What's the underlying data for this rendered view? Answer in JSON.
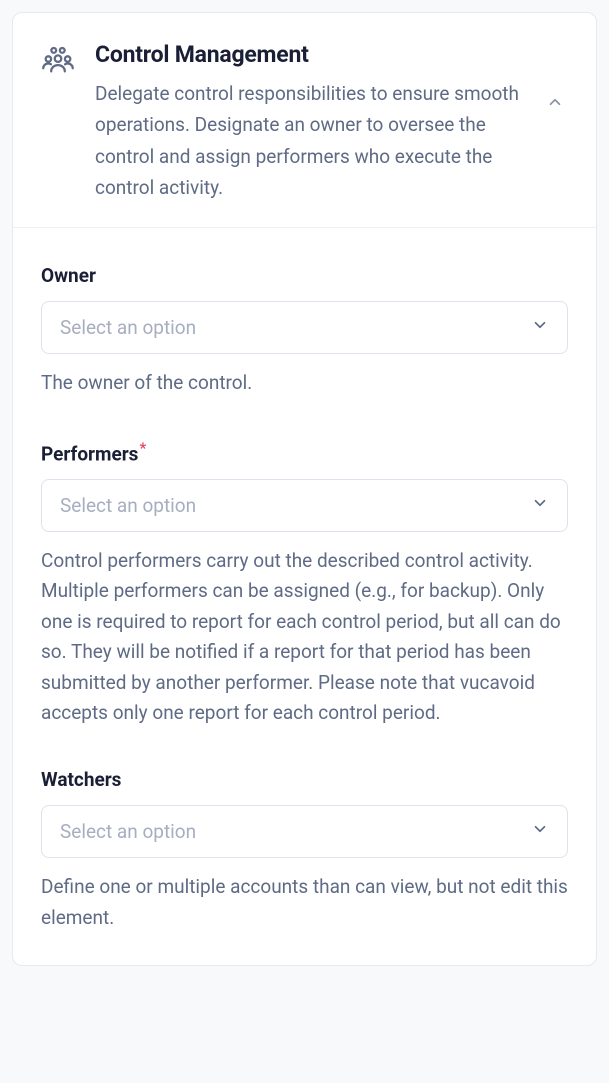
{
  "header": {
    "title": "Control Management",
    "description": "Delegate control responsibilities to ensure smooth operations. Designate an owner to oversee the control and assign performers who execute the control activity."
  },
  "fields": {
    "owner": {
      "label": "Owner",
      "required": false,
      "placeholder": "Select an option",
      "help": "The owner of the control."
    },
    "performers": {
      "label": "Performers",
      "required": true,
      "placeholder": "Select an option",
      "help": "Control performers carry out the described control activity. Multiple performers can be assigned (e.g., for backup). Only one is required to report for each control period, but all can do so. They will be notified if a report for that period has been submitted by another performer. Please note that vucavoid accepts only one report for each control period."
    },
    "watchers": {
      "label": "Watchers",
      "required": false,
      "placeholder": "Select an option",
      "help": "Define one or multiple accounts than can view, but not edit this element."
    }
  },
  "required_marker": "*"
}
